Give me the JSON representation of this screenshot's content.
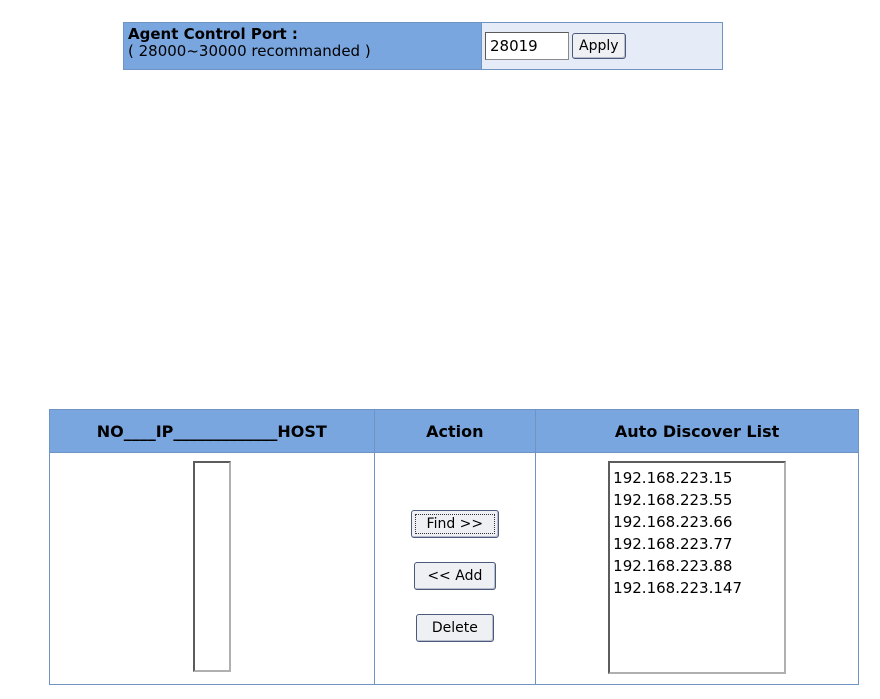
{
  "agent_port": {
    "title": "Agent Control Port :",
    "hint": "( 28000~30000 recommanded )",
    "value": "28019",
    "apply_label": "Apply"
  },
  "table": {
    "col_host_header": "NO____IP_____________HOST",
    "col_action_header": "Action",
    "col_auto_header": "Auto Discover List",
    "find_label": "Find >>",
    "add_label": "<< Add",
    "delete_label": "Delete",
    "auto_list": [
      "192.168.223.15",
      "192.168.223.55",
      "192.168.223.66",
      "192.168.223.77",
      "192.168.223.88",
      "192.168.223.147"
    ]
  },
  "colors": {
    "header_bg": "#7aa6e0",
    "value_bg": "#e6ecf7",
    "border": "#6f94c4"
  }
}
